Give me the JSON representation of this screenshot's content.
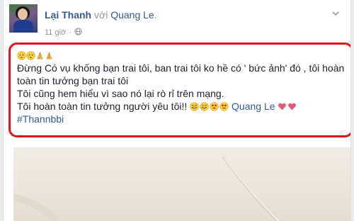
{
  "post": {
    "author": "Lại Thanh",
    "with_word": "với",
    "tagged": "Quang Le",
    "tagged_suffix": ".",
    "time": "11 giờ",
    "dot": "·",
    "privacy_icon": "globe-icon",
    "menu_icon": "chevron-down-icon"
  },
  "content": {
    "top_emojis": [
      "white-cry-face-emoji",
      "white-cry-face-emoji",
      "folded-hands-emoji",
      "folded-hands-emoji"
    ],
    "line1": "Đừng Có vụ khống bạn trai tôi, ban trai tôi ko hề có ' bức ảnh' đó , tôi hoàn",
    "line2": "toàn tin tưởng bạn trai tôi",
    "line3": "Tôi cũng hem hiểu vì sao nó lại rò rỉ trên mạng.",
    "line4_text": "Tôi hoàn toàn tin tưởng người yêu tôi!!",
    "line4_emojis": [
      "grinning-sweat-emoji",
      "grinning-sweat-emoji",
      "heart-eyes-emoji",
      "heart-eyes-emoji"
    ],
    "line4_mention": "Quang Le",
    "line4_hearts": [
      "red-heart-emoji",
      "red-heart-emoji"
    ],
    "hashtag": "#Thannbbi"
  },
  "colors": {
    "link": "#365899",
    "muted": "#90949c",
    "highlight_border": "#e0141b",
    "text": "#1d2129",
    "heart": "#e45a7a"
  }
}
